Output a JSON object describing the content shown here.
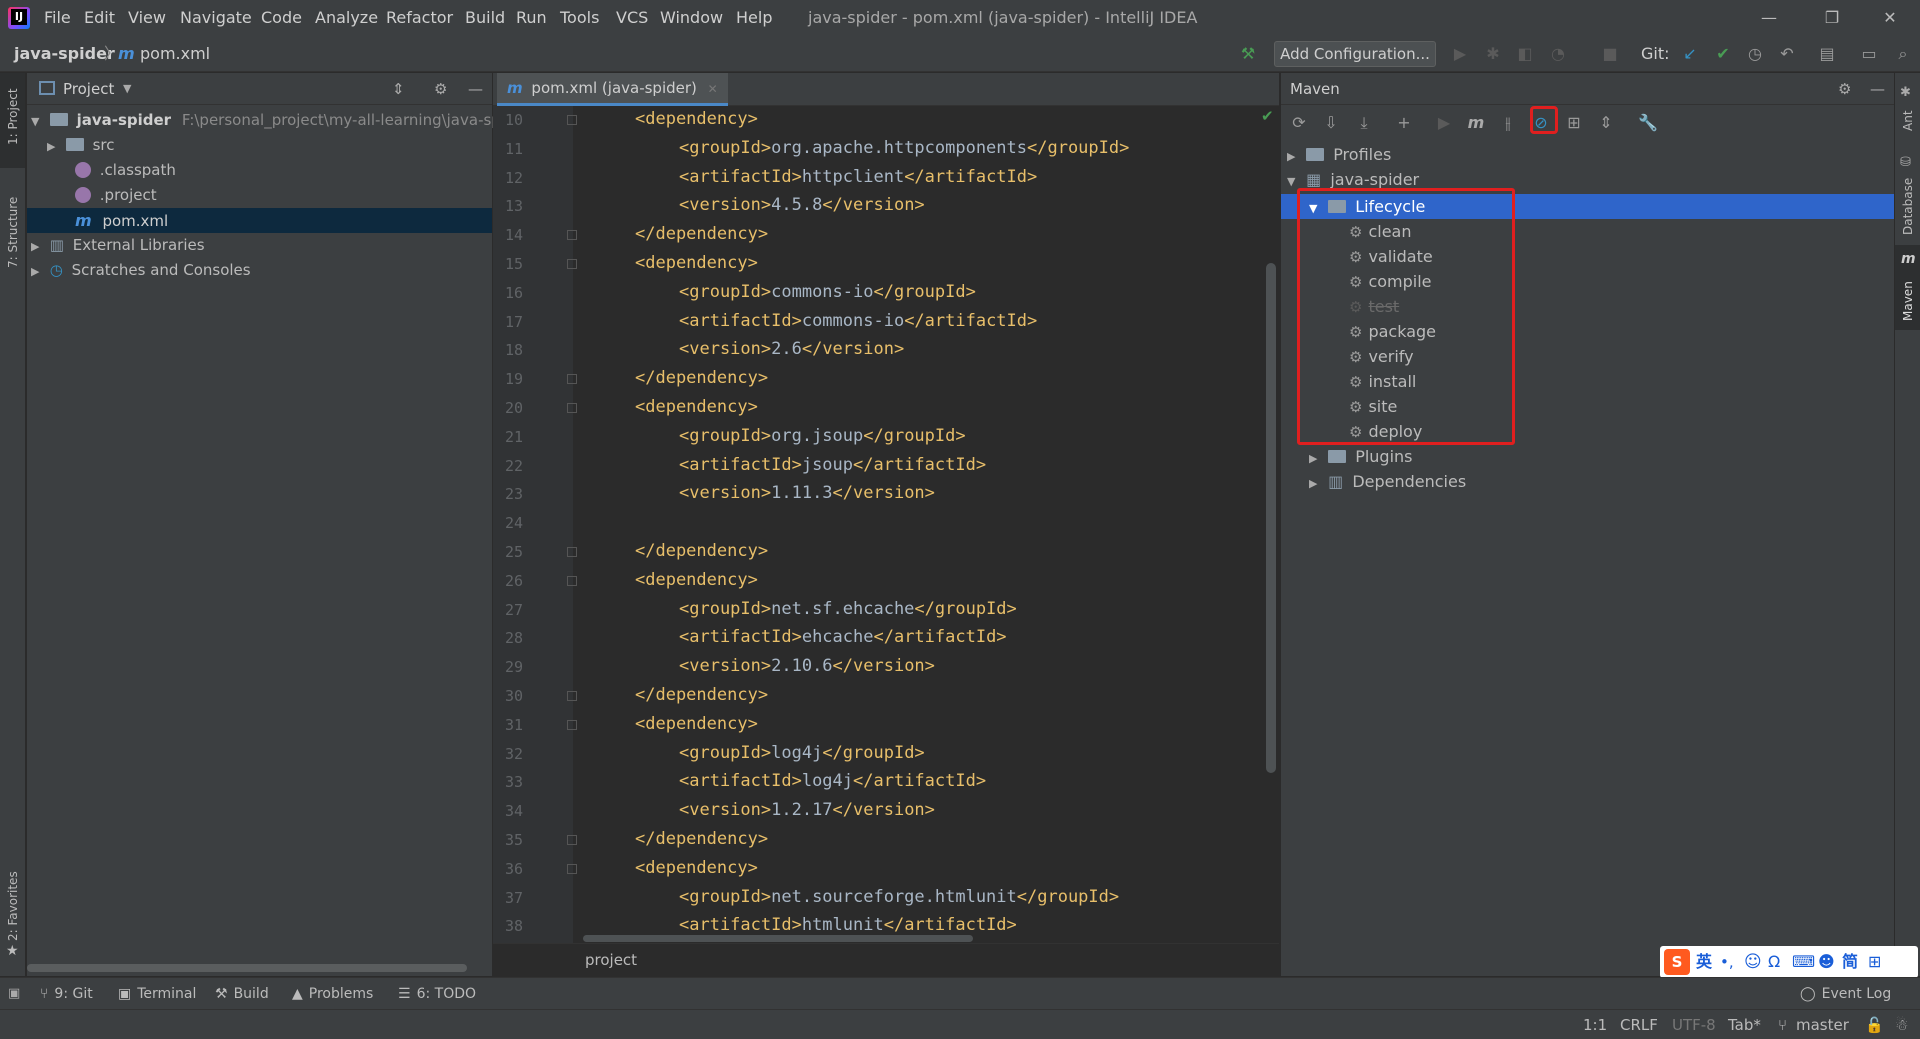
{
  "window": {
    "title": "java-spider - pom.xml (java-spider) - IntelliJ IDEA",
    "menus": [
      "File",
      "Edit",
      "View",
      "Navigate",
      "Code",
      "Analyze",
      "Refactor",
      "Build",
      "Run",
      "Tools",
      "VCS",
      "Window",
      "Help"
    ]
  },
  "navbar": {
    "project": "java-spider",
    "file": "pom.xml",
    "add_configuration": "Add Configuration...",
    "git_label": "Git:"
  },
  "left_stripe": {
    "project": "1: Project",
    "structure": "7: Structure",
    "favorites": "2: Favorites"
  },
  "project_panel": {
    "title": "Project",
    "tree": [
      {
        "label": "java-spider",
        "path": "F:\\personal_project\\my-all-learning\\java-spic"
      },
      {
        "label": "src"
      },
      {
        "label": ".classpath"
      },
      {
        "label": ".project"
      },
      {
        "label": "pom.xml"
      },
      {
        "label": "External Libraries"
      },
      {
        "label": "Scratches and Consoles"
      }
    ]
  },
  "editor": {
    "tab": "pom.xml (java-spider)",
    "breadcrumb": "project",
    "lines": [
      {
        "n": "10",
        "indent": 2,
        "open": "<dependency>",
        "text": "",
        "close": ""
      },
      {
        "n": "11",
        "indent": 3,
        "open": "<groupId>",
        "text": "org.apache.httpcomponents",
        "close": "</groupId>"
      },
      {
        "n": "12",
        "indent": 3,
        "open": "<artifactId>",
        "text": "httpclient",
        "close": "</artifactId>"
      },
      {
        "n": "13",
        "indent": 3,
        "open": "<version>",
        "text": "4.5.8",
        "close": "</version>"
      },
      {
        "n": "14",
        "indent": 2,
        "open": "</dependency>",
        "text": "",
        "close": ""
      },
      {
        "n": "15",
        "indent": 2,
        "open": "<dependency>",
        "text": "",
        "close": ""
      },
      {
        "n": "16",
        "indent": 3,
        "open": "<groupId>",
        "text": "commons-io",
        "close": "</groupId>"
      },
      {
        "n": "17",
        "indent": 3,
        "open": "<artifactId>",
        "text": "commons-io",
        "close": "</artifactId>"
      },
      {
        "n": "18",
        "indent": 3,
        "open": "<version>",
        "text": "2.6",
        "close": "</version>"
      },
      {
        "n": "19",
        "indent": 2,
        "open": "</dependency>",
        "text": "",
        "close": ""
      },
      {
        "n": "20",
        "indent": 2,
        "open": "<dependency>",
        "text": "",
        "close": ""
      },
      {
        "n": "21",
        "indent": 3,
        "open": "<groupId>",
        "text": "org.jsoup",
        "close": "</groupId>"
      },
      {
        "n": "22",
        "indent": 3,
        "open": "<artifactId>",
        "text": "jsoup",
        "close": "</artifactId>"
      },
      {
        "n": "23",
        "indent": 3,
        "open": "<version>",
        "text": "1.11.3",
        "close": "</version>"
      },
      {
        "n": "24",
        "indent": 0,
        "open": "",
        "text": "",
        "close": ""
      },
      {
        "n": "25",
        "indent": 2,
        "open": "</dependency>",
        "text": "",
        "close": ""
      },
      {
        "n": "26",
        "indent": 2,
        "open": "<dependency>",
        "text": "",
        "close": ""
      },
      {
        "n": "27",
        "indent": 3,
        "open": "<groupId>",
        "text": "net.sf.ehcache",
        "close": "</groupId>"
      },
      {
        "n": "28",
        "indent": 3,
        "open": "<artifactId>",
        "text": "ehcache",
        "close": "</artifactId>"
      },
      {
        "n": "29",
        "indent": 3,
        "open": "<version>",
        "text": "2.10.6",
        "close": "</version>"
      },
      {
        "n": "30",
        "indent": 2,
        "open": "</dependency>",
        "text": "",
        "close": ""
      },
      {
        "n": "31",
        "indent": 2,
        "open": "<dependency>",
        "text": "",
        "close": ""
      },
      {
        "n": "32",
        "indent": 3,
        "open": "<groupId>",
        "text": "log4j",
        "close": "</groupId>"
      },
      {
        "n": "33",
        "indent": 3,
        "open": "<artifactId>",
        "text": "log4j",
        "close": "</artifactId>"
      },
      {
        "n": "34",
        "indent": 3,
        "open": "<version>",
        "text": "1.2.17",
        "close": "</version>"
      },
      {
        "n": "35",
        "indent": 2,
        "open": "</dependency>",
        "text": "",
        "close": ""
      },
      {
        "n": "36",
        "indent": 2,
        "open": "<dependency>",
        "text": "",
        "close": ""
      },
      {
        "n": "37",
        "indent": 3,
        "open": "<groupId>",
        "text": "net.sourceforge.htmlunit",
        "close": "</groupId>"
      },
      {
        "n": "38",
        "indent": 3,
        "open": "<artifactId>",
        "text": "htmlunit",
        "close": "</artifactId>"
      }
    ]
  },
  "maven": {
    "title": "Maven",
    "tree": {
      "profiles": "Profiles",
      "project": "java-spider",
      "lifecycle": "Lifecycle",
      "phases": [
        "clean",
        "validate",
        "compile",
        "test",
        "package",
        "verify",
        "install",
        "site",
        "deploy"
      ],
      "plugins": "Plugins",
      "dependencies": "Dependencies"
    }
  },
  "right_stripe": {
    "ant": "Ant",
    "database": "Database",
    "maven": "Maven"
  },
  "bottom_tools": [
    "9: Git",
    "Terminal",
    "Build",
    "Problems",
    "6: TODO"
  ],
  "event_log": "Event Log",
  "status": {
    "position": "1:1",
    "line_sep": "CRLF",
    "encoding": "UTF-8",
    "indent": "Tab*",
    "branch": "master"
  },
  "ime": {
    "mode": "英",
    "simplified": "简"
  }
}
